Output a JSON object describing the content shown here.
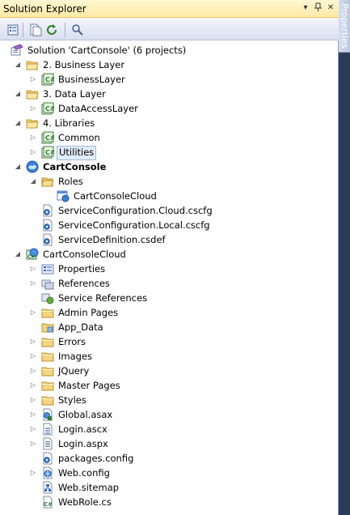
{
  "window": {
    "title": "Solution Explorer",
    "controls": {
      "dropdown": "▾",
      "pin": "📌",
      "close": "✕"
    }
  },
  "side_tab": {
    "label": "Properties"
  },
  "toolbar": {
    "buttons": [
      {
        "icon": "properties-icon"
      },
      {
        "icon": "show-all-files-icon"
      },
      {
        "icon": "refresh-icon"
      },
      {
        "icon": "view-class-diagram-icon"
      }
    ]
  },
  "tree": [
    {
      "label": "Solution 'CartConsole' (6 projects)",
      "level": 0,
      "expander": "none",
      "icon": "solution-icon",
      "bold": false
    },
    {
      "label": "2. Business Layer",
      "level": 1,
      "expander": "expanded",
      "icon": "solution-folder-open-icon",
      "bold": false
    },
    {
      "label": "BusinessLayer",
      "level": 2,
      "expander": "collapsed",
      "icon": "csharp-project-icon",
      "bold": false
    },
    {
      "label": "3. Data Layer",
      "level": 1,
      "expander": "expanded",
      "icon": "solution-folder-open-icon",
      "bold": false
    },
    {
      "label": "DataAccessLayer",
      "level": 2,
      "expander": "collapsed",
      "icon": "csharp-project-icon",
      "bold": false
    },
    {
      "label": "4. Libraries",
      "level": 1,
      "expander": "expanded",
      "icon": "solution-folder-open-icon",
      "bold": false
    },
    {
      "label": "Common",
      "level": 2,
      "expander": "collapsed",
      "icon": "csharp-project-icon",
      "bold": false
    },
    {
      "label": "Utilities",
      "level": 2,
      "expander": "collapsed",
      "icon": "csharp-project-icon",
      "bold": false,
      "selected": true
    },
    {
      "label": "CartConsole",
      "level": 1,
      "expander": "expanded",
      "icon": "cloud-project-icon",
      "bold": true
    },
    {
      "label": "Roles",
      "level": 2,
      "expander": "expanded",
      "icon": "folder-open-icon",
      "bold": false
    },
    {
      "label": "CartConsoleCloud",
      "level": 3,
      "expander": "none",
      "icon": "web-role-icon",
      "bold": false
    },
    {
      "label": "ServiceConfiguration.Cloud.cscfg",
      "level": 2,
      "expander": "none",
      "icon": "config-file-icon",
      "bold": false
    },
    {
      "label": "ServiceConfiguration.Local.cscfg",
      "level": 2,
      "expander": "none",
      "icon": "config-file-icon",
      "bold": false
    },
    {
      "label": "ServiceDefinition.csdef",
      "level": 2,
      "expander": "none",
      "icon": "config-file-icon",
      "bold": false
    },
    {
      "label": "CartConsoleCloud",
      "level": 1,
      "expander": "expanded",
      "icon": "web-project-icon",
      "bold": false
    },
    {
      "label": "Properties",
      "level": 2,
      "expander": "collapsed",
      "icon": "properties-folder-icon",
      "bold": false
    },
    {
      "label": "References",
      "level": 2,
      "expander": "collapsed",
      "icon": "references-icon",
      "bold": false
    },
    {
      "label": "Service References",
      "level": 2,
      "expander": "none",
      "icon": "service-references-icon",
      "bold": false
    },
    {
      "label": "Admin Pages",
      "level": 2,
      "expander": "collapsed",
      "icon": "folder-icon",
      "bold": false
    },
    {
      "label": "App_Data",
      "level": 2,
      "expander": "none",
      "icon": "app-data-folder-icon",
      "bold": false
    },
    {
      "label": "Errors",
      "level": 2,
      "expander": "collapsed",
      "icon": "folder-icon",
      "bold": false
    },
    {
      "label": "Images",
      "level": 2,
      "expander": "collapsed",
      "icon": "folder-icon",
      "bold": false
    },
    {
      "label": "JQuery",
      "level": 2,
      "expander": "collapsed",
      "icon": "folder-icon",
      "bold": false
    },
    {
      "label": "Master Pages",
      "level": 2,
      "expander": "collapsed",
      "icon": "folder-icon",
      "bold": false
    },
    {
      "label": "Styles",
      "level": 2,
      "expander": "collapsed",
      "icon": "folder-icon",
      "bold": false
    },
    {
      "label": "Global.asax",
      "level": 2,
      "expander": "collapsed",
      "icon": "asax-file-icon",
      "bold": false
    },
    {
      "label": "Login.ascx",
      "level": 2,
      "expander": "collapsed",
      "icon": "ascx-file-icon",
      "bold": false
    },
    {
      "label": "Login.aspx",
      "level": 2,
      "expander": "collapsed",
      "icon": "aspx-file-icon",
      "bold": false
    },
    {
      "label": "packages.config",
      "level": 2,
      "expander": "none",
      "icon": "config-file-icon",
      "bold": false
    },
    {
      "label": "Web.config",
      "level": 2,
      "expander": "collapsed",
      "icon": "web-config-icon",
      "bold": false
    },
    {
      "label": "Web.sitemap",
      "level": 2,
      "expander": "none",
      "icon": "sitemap-file-icon",
      "bold": false
    },
    {
      "label": "WebRole.cs",
      "level": 2,
      "expander": "none",
      "icon": "csharp-file-icon",
      "bold": false
    }
  ]
}
